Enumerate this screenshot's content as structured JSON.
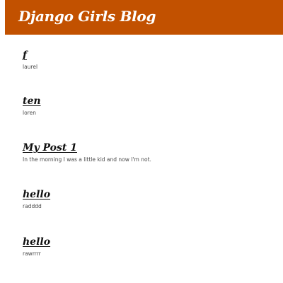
{
  "header": {
    "title": "Django Girls Blog",
    "background_color": "#c25100"
  },
  "posts": [
    {
      "title": "f",
      "text": "laurel"
    },
    {
      "title": "ten",
      "text": "loren"
    },
    {
      "title": "My Post 1",
      "text": "In the morning I was a little kid and now I'm not."
    },
    {
      "title": "hello",
      "text": "radddd"
    },
    {
      "title": "hello",
      "text": "rawrrrr"
    }
  ]
}
